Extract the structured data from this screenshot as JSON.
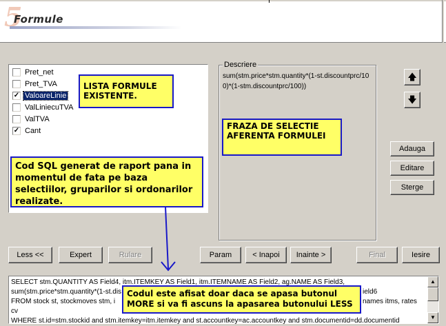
{
  "header": {
    "step_number": "5",
    "title": "Formule"
  },
  "formula_list": {
    "items": [
      {
        "label": "Pret_net",
        "checked": false,
        "selected": false
      },
      {
        "label": "Pret_TVA",
        "checked": false,
        "selected": false
      },
      {
        "label": "ValoareLinie",
        "checked": true,
        "selected": true
      },
      {
        "label": "ValLiniecuTVA",
        "checked": false,
        "selected": false
      },
      {
        "label": "ValTVA",
        "checked": false,
        "selected": false
      },
      {
        "label": "Cant",
        "checked": true,
        "selected": false
      }
    ]
  },
  "description": {
    "legend": "Descriere",
    "text": "sum(stm.price*stm.quantity*(1-st.discountprc/100)*(1-stm.discountprc/100))"
  },
  "side_buttons": {
    "add": "Adauga",
    "edit": "Editare",
    "delete": "Sterge"
  },
  "nav_buttons": {
    "less": "Less <<",
    "expert": "Expert",
    "run": "Rulare",
    "param": "Param",
    "back": "< Inapoi",
    "next": "Inainte >",
    "finish": "Final",
    "exit": "Iesire"
  },
  "sql": {
    "lines": [
      "SELECT stm.QUANTITY AS Field4, itm.ITEMKEY AS Field1, itm.ITEMNAME AS Field2, ag.NAME AS Field3,",
      "sum(stm.price*stm.quantity*(1-st.dis",
      "FROM stock st, stockmoves stm, i",
      "cv",
      "WHERE st.id=stm.stockid and stm.itemkey=itm.itemkey and st.accountkey=ac.accountkey and stm.documentid=dd.documentid"
    ],
    "line2_right": "ield6",
    "line3_right": "names itms, rates"
  },
  "annotations": {
    "lista": "LISTA FORMULE EXISTENTE.",
    "fraza": "FRAZA DE SELECTIE AFERENTA FORMULEI",
    "cod_sql": "Cod SQL generat de raport pana in momentul de fata pe baza selectiilor, gruparilor si ordonarilor realizate.",
    "codul": "Codul este afisat doar daca se apasa butonul MORE si va fi ascuns la apasarea butonului LESS"
  },
  "colors": {
    "note_bg": "#ffff66",
    "note_border": "#1818c8",
    "selection": "#0a246a",
    "face": "#d4d0c8"
  }
}
